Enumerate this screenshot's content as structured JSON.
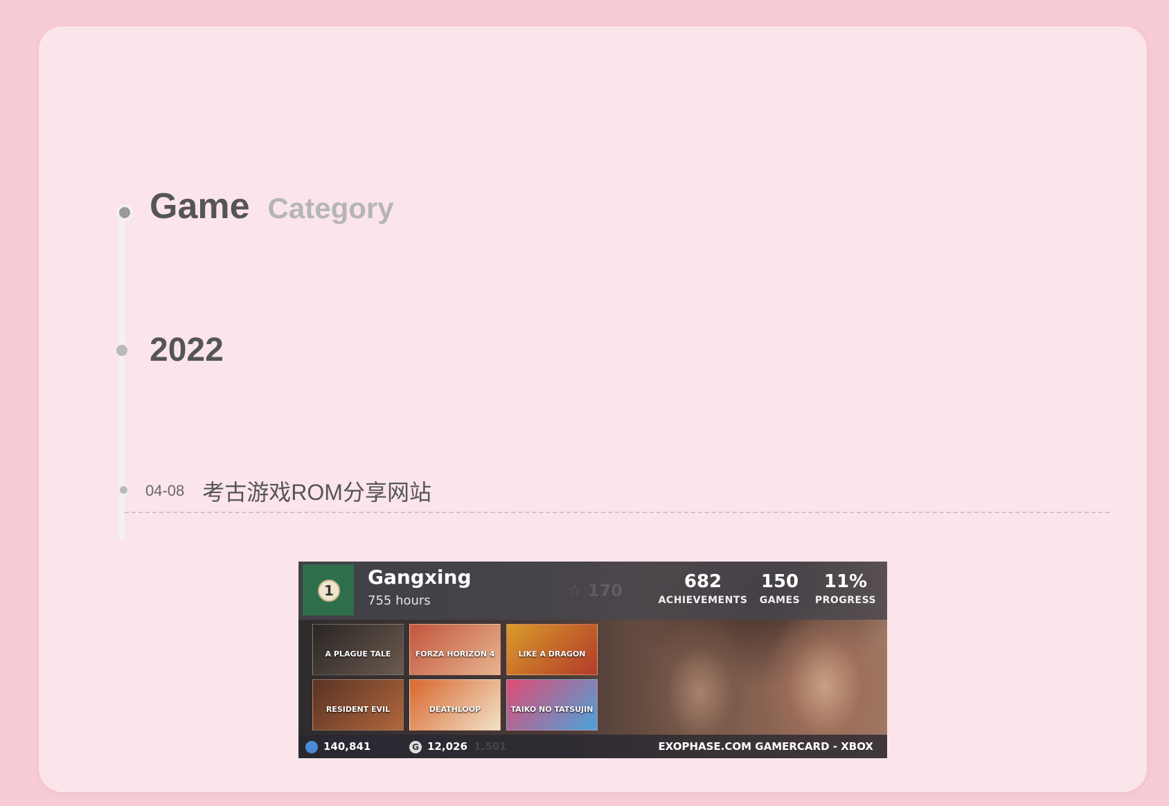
{
  "heading": {
    "main": "Game",
    "sub": "Category"
  },
  "year": "2022",
  "post": {
    "date": "04-08",
    "title": "考古游戏ROM分享网站"
  },
  "gamercard": {
    "level": "1",
    "name": "Gangxing",
    "hours": "755 hours",
    "faded_value": "170",
    "stats": [
      {
        "value": "682",
        "label": "ACHIEVEMENTS"
      },
      {
        "value": "150",
        "label": "GAMES"
      },
      {
        "value": "11%",
        "label": "PROGRESS"
      }
    ],
    "tiles": [
      {
        "label": "A PLAGUE TALE",
        "color1": "#2a2624",
        "color2": "#6b5a4f"
      },
      {
        "label": "FORZA HORIZON 4",
        "color1": "#c2563c",
        "color2": "#e7b48f"
      },
      {
        "label": "LIKE A DRAGON",
        "color1": "#d99b2b",
        "color2": "#b23a2a"
      },
      {
        "label": "RESIDENT EVIL",
        "color1": "#5a3324",
        "color2": "#b0673c"
      },
      {
        "label": "DEATHLOOP",
        "color1": "#d9672e",
        "color2": "#f1e2c8"
      },
      {
        "label": "TAIKO NO TATSUJIN",
        "color1": "#e14b74",
        "color2": "#4aa3d9"
      }
    ],
    "footer": {
      "world_rank": "140,841",
      "gamerscore": "12,026",
      "faded_value": "1,501",
      "source": "EXOPHASE.COM GAMERCARD - XBOX"
    }
  },
  "colors": {
    "page_bg": "#f7ccd6",
    "card_bg": "#fbe5ea",
    "text_dark": "#555555",
    "text_muted": "#b5b5b5",
    "level_bg": "#2f6e4b"
  }
}
